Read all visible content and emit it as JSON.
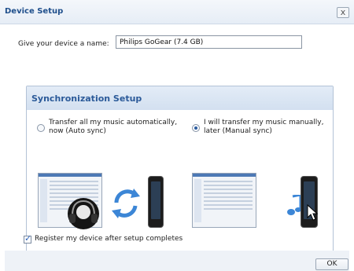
{
  "dialog": {
    "title": "Device Setup",
    "close_label": "x"
  },
  "name": {
    "label": "Give your device a name:",
    "value": "Philips GoGear (7.4 GB)"
  },
  "sync": {
    "title": "Synchronization Setup",
    "auto": {
      "line1": "Transfer all my music automatically,",
      "line2": "now (Auto sync)",
      "checked": false
    },
    "manual": {
      "line1": "I will transfer my music manually,",
      "line2": "later (Manual sync)",
      "checked": true
    }
  },
  "register": {
    "label": "Register my device after setup completes",
    "checked": true
  },
  "footer": {
    "ok_label": "OK"
  },
  "icons": {
    "auto_illustration": [
      "music-library-screen-icon",
      "headphones-icon",
      "sync-arrows-icon",
      "mp3-player-icon"
    ],
    "manual_illustration": [
      "music-library-screen-icon",
      "music-note-icon",
      "mp3-player-icon",
      "mouse-cursor-icon"
    ]
  },
  "colors": {
    "accent": "#2b5a99",
    "title": "#1f4f8c",
    "sync_arrow": "#3c86d6"
  }
}
